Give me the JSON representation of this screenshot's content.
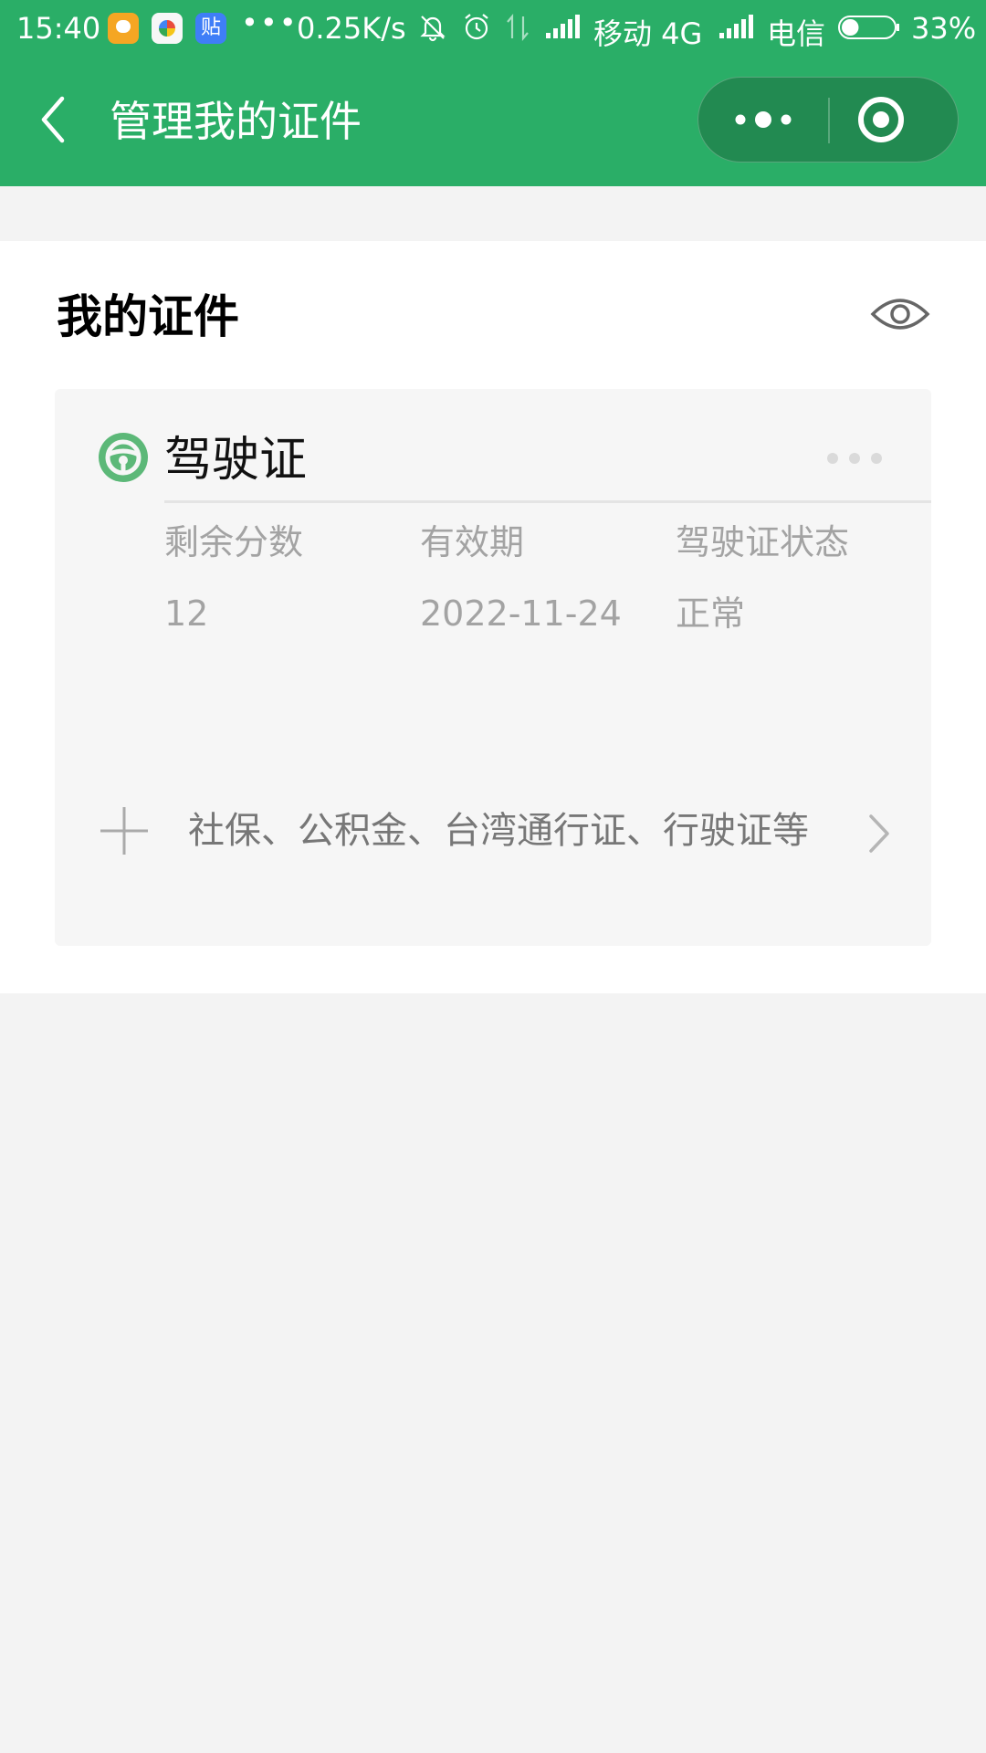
{
  "status_bar": {
    "time": "15:40",
    "badge_3_text": "贴",
    "more": "•••",
    "speed": "0.25K/s",
    "carrier_1": "移动 4G",
    "carrier_2": "电信",
    "battery": "33%",
    "battery_level": 0.33
  },
  "nav": {
    "title": "管理我的证件"
  },
  "section": {
    "title": "我的证件"
  },
  "license": {
    "name": "驾驶证",
    "fields": [
      {
        "label": "剩余分数",
        "value": "12"
      },
      {
        "label": "有效期",
        "value": "2022-11-24"
      },
      {
        "label": "驾驶证状态",
        "value": "正常"
      }
    ]
  },
  "add_card": {
    "text": "社保、公积金、台湾通行证、行驶证等"
  },
  "colors": {
    "brand_green": "#2aae67",
    "capsule_green": "#228a51",
    "steering_green": "#5cb878"
  }
}
